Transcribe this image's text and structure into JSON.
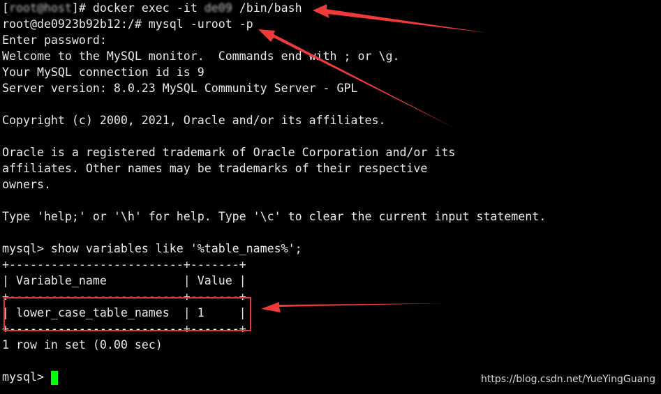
{
  "terminal": {
    "lines": [
      {
        "before": "[",
        "blur": "root@host",
        "after": "]# docker exec -it ",
        "blur2": "de09",
        "after2": " /bin/bash"
      },
      "root@de0923b92b12:/# mysql -uroot -p",
      "Enter password:",
      "Welcome to the MySQL monitor.  Commands end with ; or \\g.",
      "Your MySQL connection id is 9",
      "Server version: 8.0.23 MySQL Community Server - GPL",
      "",
      "Copyright (c) 2000, 2021, Oracle and/or its affiliates.",
      "",
      "Oracle is a registered trademark of Oracle Corporation and/or its",
      "affiliates. Other names may be trademarks of their respective",
      "owners.",
      "",
      "Type 'help;' or '\\h' for help. Type '\\c' to clear the current input statement.",
      "",
      "mysql> show variables like '%table_names%';",
      "+-------------------------+-------+",
      "| Variable_name           | Value |",
      "+-------------------------+-------+",
      "| lower_case_table_names  | 1     |",
      "+-------------------------+-------+",
      "1 row in set (0.00 sec)",
      ""
    ],
    "prompt": "mysql> ",
    "cursor_color": "#00ff00"
  },
  "annotations": {
    "arrow_color": "#f03a3a",
    "box_color": "#e53935"
  },
  "watermark": "https://blog.csdn.net/YueYingGuang"
}
